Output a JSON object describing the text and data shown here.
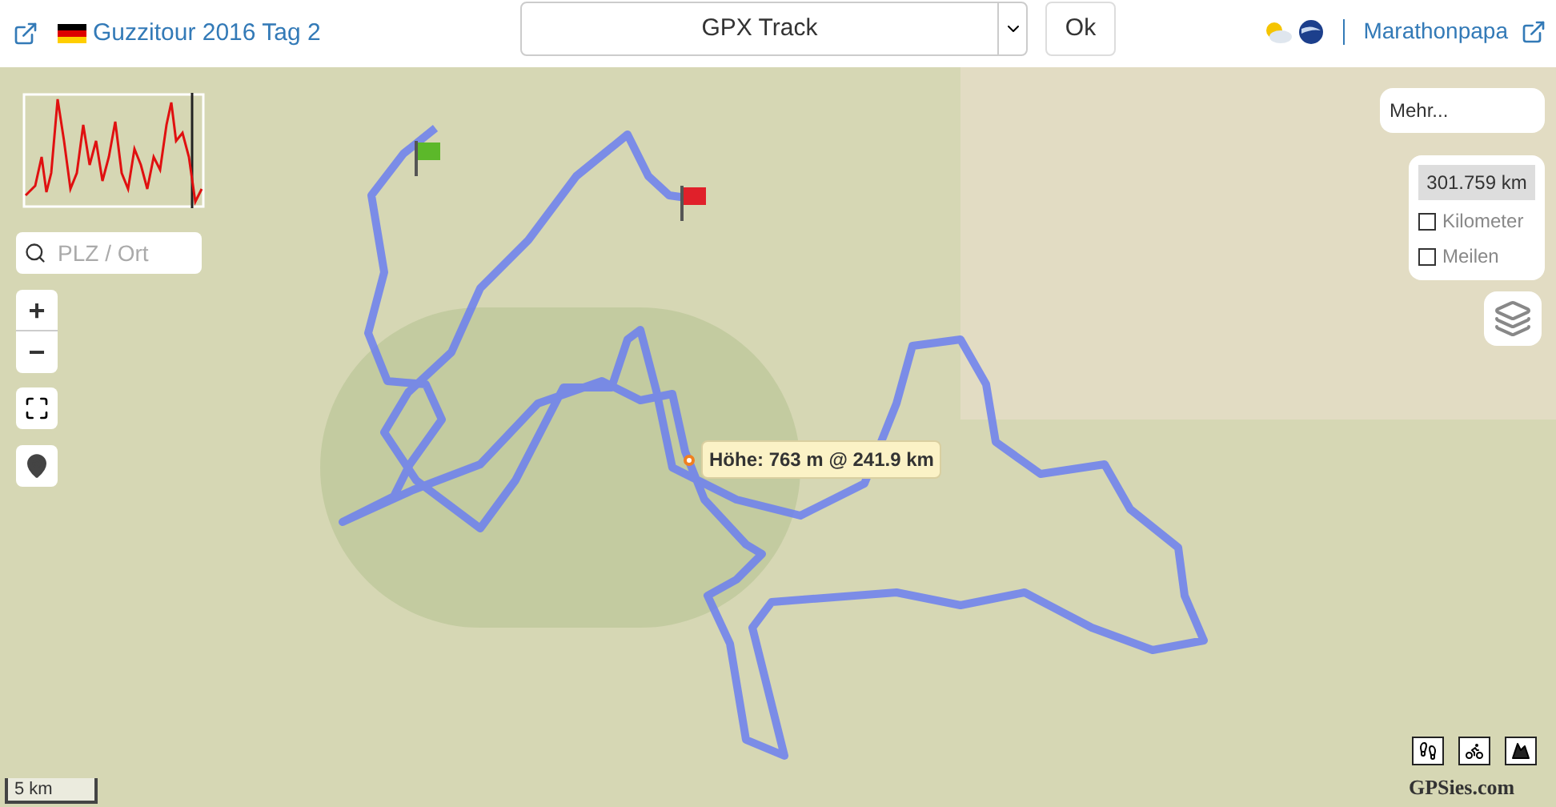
{
  "header": {
    "title": "Guzzitour 2016 Tag 2",
    "track_select": {
      "value": "GPX Track"
    },
    "ok_button": "Ok",
    "user": "Marathonpapa"
  },
  "map": {
    "search": {
      "placeholder": "PLZ / Ort"
    },
    "zoom_in": "+",
    "zoom_out": "−",
    "more_button": "Mehr...",
    "distance": "301.759 km",
    "units": [
      {
        "label": "Kilometer",
        "checked": false
      },
      {
        "label": "Meilen",
        "checked": false
      }
    ],
    "tooltip": "Höhe: 763 m @ 241.9 km",
    "scale": "5 km",
    "logo": "GPSies.com"
  }
}
